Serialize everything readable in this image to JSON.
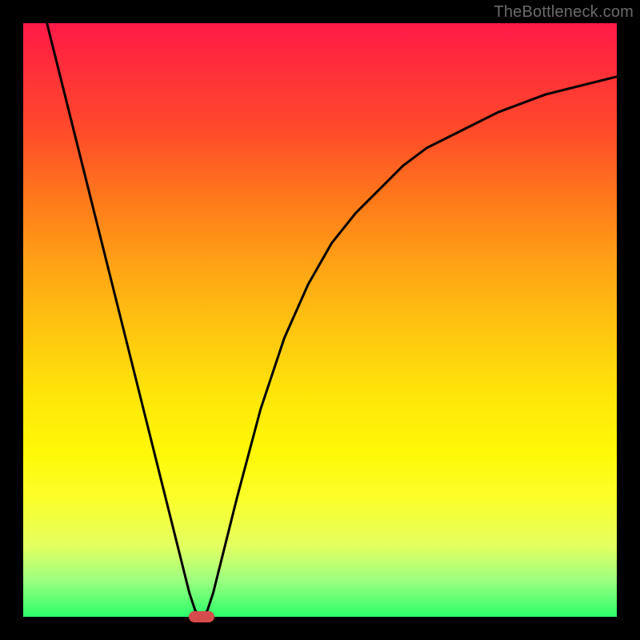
{
  "watermark": "TheBottleneck.com",
  "chart_data": {
    "type": "line",
    "title": "",
    "xlabel": "",
    "ylabel": "",
    "xlim": [
      0,
      100
    ],
    "ylim": [
      0,
      100
    ],
    "grid": false,
    "series": [
      {
        "name": "curve",
        "x": [
          4,
          8,
          12,
          16,
          20,
          24,
          26,
          28,
          29,
          30,
          31,
          32,
          34,
          36,
          40,
          44,
          48,
          52,
          56,
          60,
          64,
          68,
          72,
          76,
          80,
          84,
          88,
          92,
          96,
          100
        ],
        "y": [
          100,
          84,
          68,
          52,
          36,
          20,
          12,
          4,
          1,
          0,
          1,
          4,
          12,
          20,
          35,
          47,
          56,
          63,
          68,
          72,
          76,
          79,
          81,
          83,
          85,
          86.5,
          88,
          89,
          90,
          91
        ]
      }
    ],
    "marker": {
      "x": 30,
      "y": 0,
      "color": "#d64b4b"
    },
    "background_gradient": {
      "top": "#ff1a48",
      "bottom": "#2bff6a"
    }
  }
}
